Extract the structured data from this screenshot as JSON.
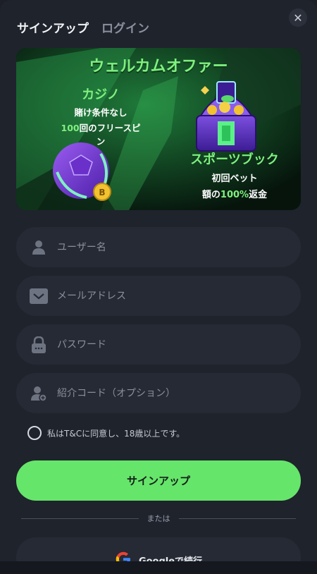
{
  "tabs": {
    "signup": "サインアップ",
    "login": "ログイン"
  },
  "close_glyph": "✕",
  "banner": {
    "title": "ウェルカムオファー",
    "casino": {
      "heading": "カジノ",
      "line1": "賭け条件なし",
      "line2_highlight": "100",
      "line2_rest": "回のフリースピン"
    },
    "sports": {
      "heading": "スポーツブック",
      "line1": "初回ベット",
      "line2_pre": "額の",
      "line2_highlight": "100%",
      "line2_post": "返金"
    },
    "coin_symbol": "B"
  },
  "form": {
    "username_placeholder": "ユーザー名",
    "email_placeholder": "メールアドレス",
    "password_placeholder": "パスワード",
    "referral_placeholder": "紹介コード（オプション）"
  },
  "terms_text": "私はT&Cに同意し、18歳以上です。",
  "submit_label": "サインアップ",
  "divider_text": "または",
  "google_label": "Googleで続行",
  "colors": {
    "accent": "#66e56b",
    "background": "#1f232c",
    "field": "#262a34"
  }
}
